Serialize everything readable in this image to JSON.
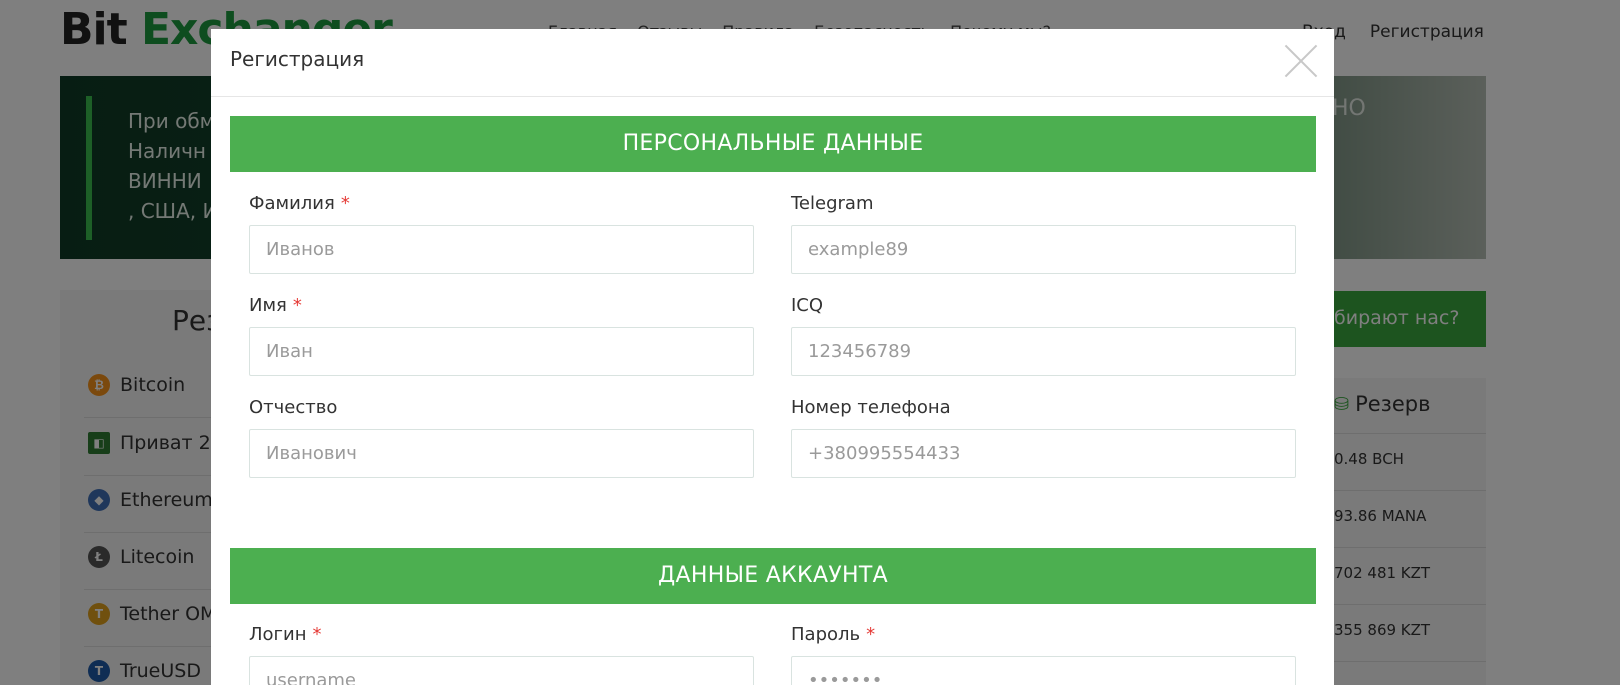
{
  "background": {
    "logo": {
      "part1": "Bit",
      "part2": "Exchanger"
    },
    "nav": [
      "Главная",
      "Отзывы",
      "Правила",
      "Безопасность",
      "Почему мы?"
    ],
    "auth": {
      "login": "Вход",
      "register": "Регистрация"
    },
    "banner": {
      "lines": [
        "При обм",
        "Наличн",
        "ВИННИ",
        ", США, И"
      ],
      "right_text": "НО"
    },
    "reserves": {
      "heading": "Рез",
      "items": [
        {
          "label": "Bitcoin",
          "icon": "bitcoin-icon",
          "color": "#f7931a"
        },
        {
          "label": "Приват 2",
          "icon": "privat-icon",
          "color": "#2e7d32"
        },
        {
          "label": "Ethereum",
          "icon": "ethereum-icon",
          "color": "#3f6fb6"
        },
        {
          "label": "Litecoin",
          "icon": "litecoin-icon",
          "color": "#555555"
        },
        {
          "label": "Tether OM",
          "icon": "tether-icon",
          "color": "#e0a01c"
        },
        {
          "label": "TrueUSD",
          "icon": "trueusd-icon",
          "color": "#1e5aa8"
        }
      ]
    },
    "why_button": "бирают нас?",
    "reserve_table": {
      "heading": "Резерв",
      "rows": [
        "0.48 BCH",
        "93.86 MANA",
        "702 481 KZT",
        "355 869 KZT"
      ]
    }
  },
  "modal": {
    "title": "Регистрация",
    "section_personal": "ПЕРСОНАЛЬНЫЕ ДАННЫЕ",
    "section_account": "ДАННЫЕ АККАУНТА",
    "fields": {
      "last_name": {
        "label": "Фамилия",
        "required": "*",
        "placeholder": "Иванов"
      },
      "telegram": {
        "label": "Telegram",
        "placeholder": "example89"
      },
      "first_name": {
        "label": "Имя",
        "required": "*",
        "placeholder": "Иван"
      },
      "icq": {
        "label": "ICQ",
        "placeholder": "123456789"
      },
      "patronymic": {
        "label": "Отчество",
        "placeholder": "Иванович"
      },
      "phone": {
        "label": "Номер телефона",
        "placeholder": "+380995554433"
      },
      "login": {
        "label": "Логин",
        "required": "*",
        "placeholder": "username"
      },
      "password": {
        "label": "Пароль",
        "required": "*",
        "placeholder": "•••••••"
      }
    }
  }
}
